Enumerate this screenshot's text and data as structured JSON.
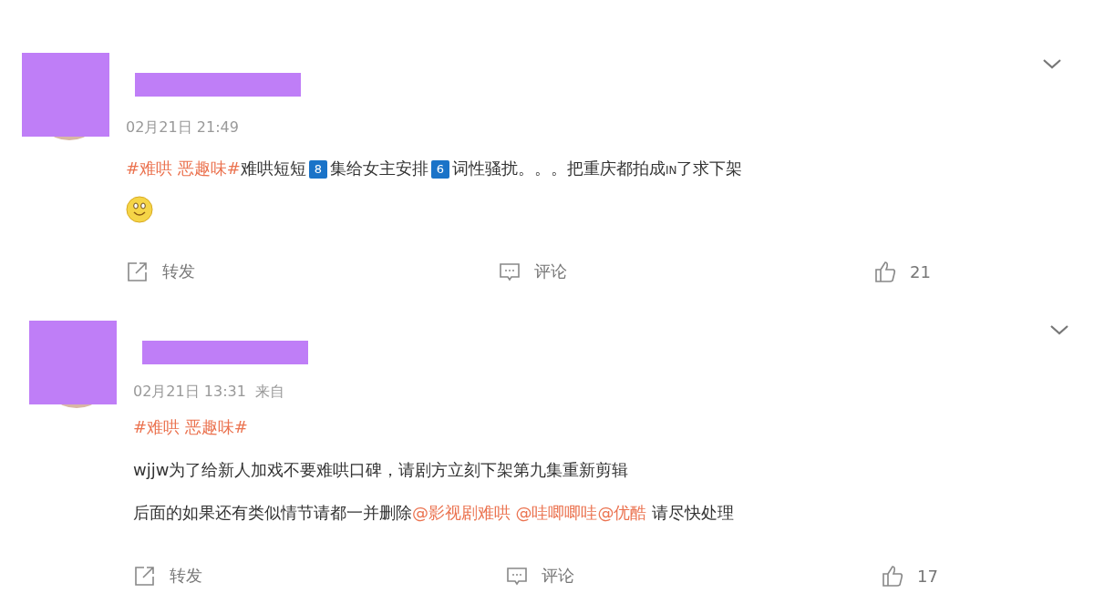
{
  "posts": [
    {
      "time": "02月21日 21:49",
      "lines": [
        [
          {
            "kind": "topic",
            "text": "#难哄 恶趣味#"
          },
          {
            "kind": "text",
            "text": "难哄短短"
          },
          {
            "kind": "keycap",
            "text": "8"
          },
          {
            "kind": "text",
            "text": "集给女主安排"
          },
          {
            "kind": "keycap",
            "text": "6"
          },
          {
            "kind": "text",
            "text": "词性骚扰。。。把重庆都拍成"
          },
          {
            "kind": "small",
            "text": "IN"
          },
          {
            "kind": "text",
            "text": "了求下架"
          }
        ],
        [
          {
            "kind": "emoji"
          }
        ]
      ],
      "actions": {
        "repost": "转发",
        "comment": "评论",
        "likes": "21"
      }
    },
    {
      "time": "02月21日 13:31",
      "source": "来自",
      "lines": [
        [
          {
            "kind": "topic",
            "text": "#难哄 恶趣味#"
          }
        ],
        [
          {
            "kind": "text",
            "text": "wjjw为了给新人加戏不要难哄口碑，请剧方立刻下架第九集重新剪辑"
          }
        ],
        [
          {
            "kind": "text",
            "text": "后面的如果还有类似情节请都一并删除"
          },
          {
            "kind": "mention",
            "text": "@影视剧难哄"
          },
          {
            "kind": "mention",
            "text": "@哇唧唧哇",
            "space_before": true
          },
          {
            "kind": "mention",
            "text": "@优酷"
          },
          {
            "kind": "text",
            "text": " 请尽快处理"
          }
        ]
      ],
      "actions": {
        "repost": "转发",
        "comment": "评论",
        "likes": "17"
      }
    }
  ]
}
